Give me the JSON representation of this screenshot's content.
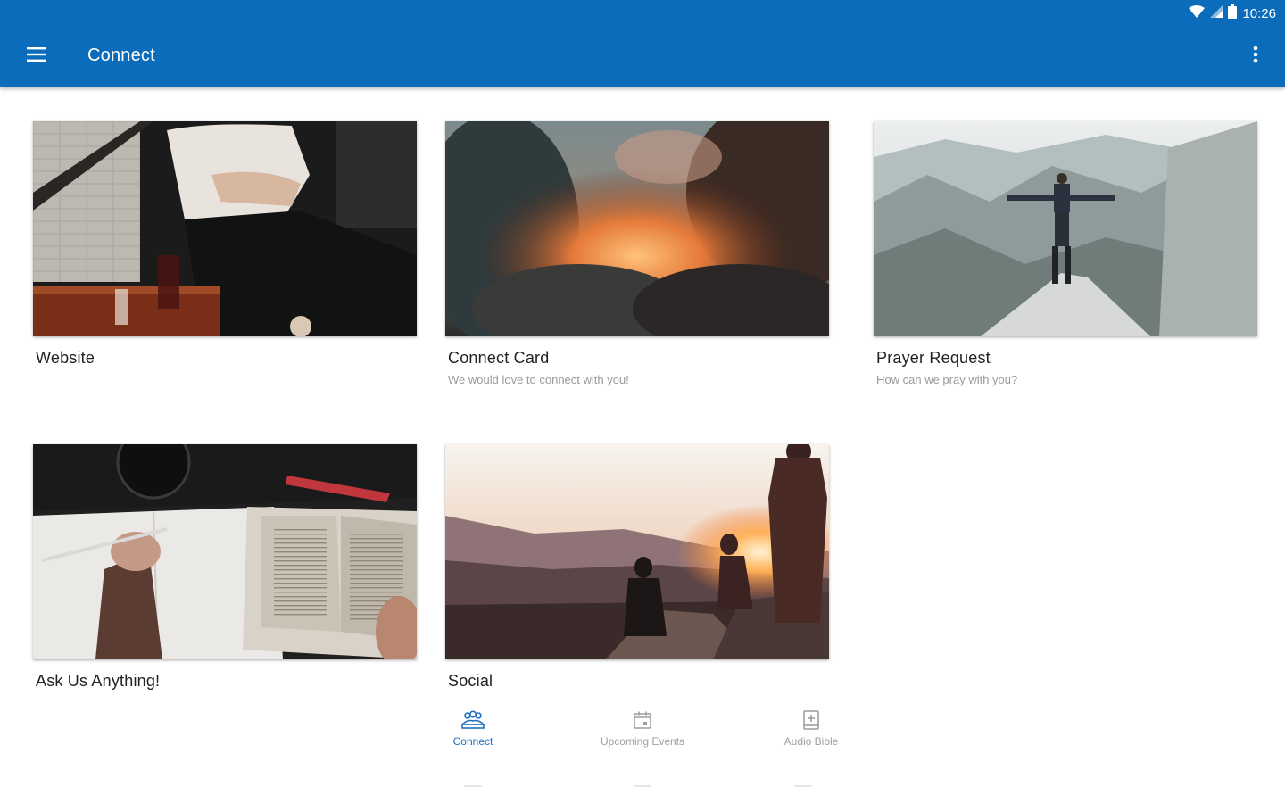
{
  "status_bar": {
    "time": "10:26",
    "icons": [
      "wifi-icon",
      "signal-icon",
      "battery-icon"
    ]
  },
  "app_bar": {
    "title": "Connect",
    "menu_icon": "hamburger-menu-icon",
    "overflow_icon": "more-vert-icon"
  },
  "cards": [
    {
      "title": "Website",
      "subtitle": "",
      "image": "person-seated-with-drink-photo"
    },
    {
      "title": "Connect Card",
      "subtitle": "We would love to connect with you!",
      "image": "sunset-clouds-photo"
    },
    {
      "title": "Prayer Request",
      "subtitle": "How can we pray with you?",
      "image": "man-on-mountain-peak-photo"
    },
    {
      "title": "Ask Us Anything!",
      "subtitle": "",
      "image": "notebook-and-bible-photo"
    },
    {
      "title": "Social",
      "subtitle": "",
      "image": "friends-at-sunset-photo"
    }
  ],
  "bottom_nav": {
    "items": [
      {
        "label": "Connect",
        "icon": "people-group-icon",
        "active": true
      },
      {
        "label": "Upcoming Events",
        "icon": "calendar-icon",
        "active": false
      },
      {
        "label": "Audio Bible",
        "icon": "audio-book-icon",
        "active": false
      }
    ]
  },
  "colors": {
    "primary": "#0b6cbc",
    "active_nav": "#1f6fc4",
    "inactive_nav": "#9e9e9e",
    "title_text": "#222222",
    "subtitle_text": "#9a9a9a"
  }
}
